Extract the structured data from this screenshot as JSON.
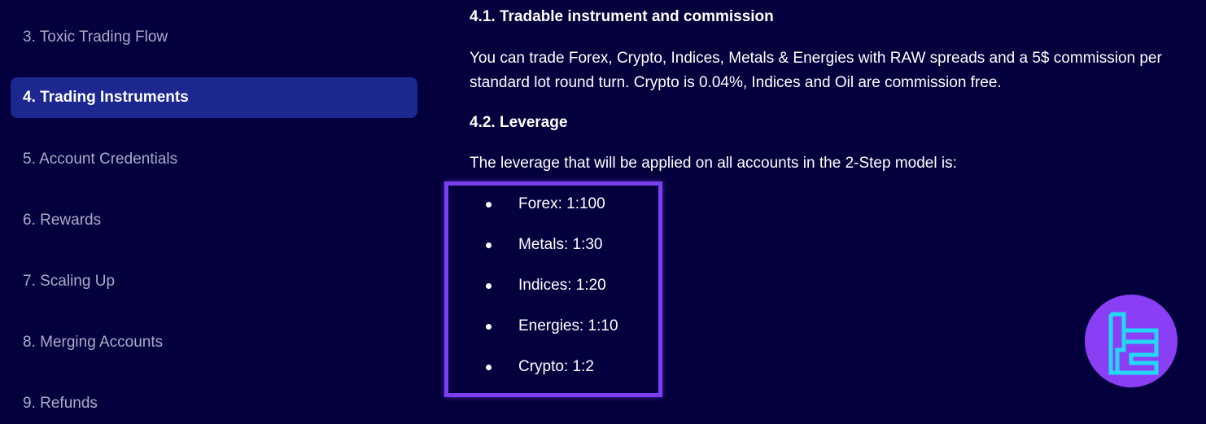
{
  "sidebar": {
    "items": [
      {
        "label": "3. Toxic Trading Flow",
        "active": false
      },
      {
        "label": "4. Trading Instruments",
        "active": true
      },
      {
        "label": "5. Account Credentials",
        "active": false
      },
      {
        "label": "6. Rewards",
        "active": false
      },
      {
        "label": "7. Scaling Up",
        "active": false
      },
      {
        "label": "8. Merging Accounts",
        "active": false
      },
      {
        "label": "9. Refunds",
        "active": false
      }
    ]
  },
  "content": {
    "section_4_1": {
      "title": "4.1. Tradable instrument and commission",
      "body_line1": "You can trade Forex, Crypto, Indices, Metals & Energies with RAW spreads and a 5$ commission per",
      "body_line2": "standard lot round turn. Crypto is 0.04%, Indices and Oil are commission free."
    },
    "section_4_2": {
      "title": "4.2. Leverage",
      "intro": "The leverage that will be applied on all accounts in the 2-Step model is:",
      "items": [
        "Forex: 1:100",
        "Metals: 1:30",
        "Indices: 1:20",
        "Energies: 1:10",
        "Crypto: 1:2"
      ]
    }
  },
  "colors": {
    "background": "#04003d",
    "active_nav": "#1c2890",
    "highlight_border": "#7b3ff0",
    "logo_bg": "#8a3ff5",
    "logo_mark": "#23d8f5"
  },
  "logo": {
    "icon": "tc-logo-icon"
  }
}
